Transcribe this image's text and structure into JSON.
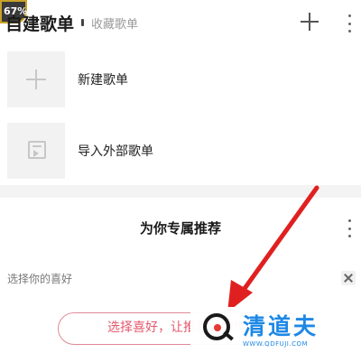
{
  "status": {
    "badge": "67%"
  },
  "header": {
    "tabs": [
      {
        "label": "自建歌单",
        "active": true
      },
      {
        "label": "收藏歌单",
        "active": false
      }
    ],
    "add_icon": "plus-icon",
    "more_icon": "more-vertical-icon"
  },
  "playlist_actions": [
    {
      "label": "新建歌单",
      "icon": "plus-icon"
    },
    {
      "label": "导入外部歌单",
      "icon": "import-icon"
    }
  ],
  "recommend": {
    "title": "为你专属推荐",
    "preference_label": "选择你的喜好",
    "choose_button": "选择喜好，让推荐更懂你",
    "close_icon": "close-icon",
    "more_icon": "more-vertical-icon"
  },
  "annotation": {
    "arrow_color": "#e02020"
  },
  "watermark": {
    "logo_text": "清道夫",
    "url": "WWW.QDFUJI.COM"
  },
  "colors": {
    "accent": "#e25a6e",
    "watermark_blue": "#1e88e5"
  }
}
